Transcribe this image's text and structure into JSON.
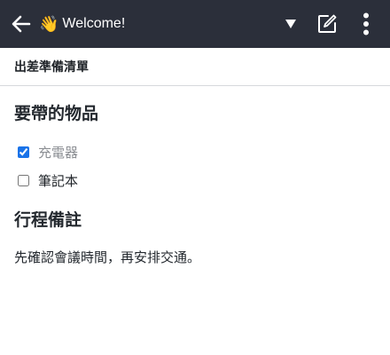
{
  "appbar": {
    "title": "Welcome!",
    "emoji": "👋",
    "icons": [
      "back-arrow-icon",
      "dropdown-triangle-icon",
      "edit-note-icon",
      "more-vertical-icon"
    ],
    "background": "#2b2f3a"
  },
  "document": {
    "title": "出差準備清單"
  },
  "items_section": {
    "heading": "要帶的物品",
    "items": [
      {
        "label": "充電器",
        "checked": true
      },
      {
        "label": "筆記本",
        "checked": false
      }
    ]
  },
  "notes_section": {
    "heading": "行程備註",
    "text": "先確認會議時間，再安排交通。"
  }
}
